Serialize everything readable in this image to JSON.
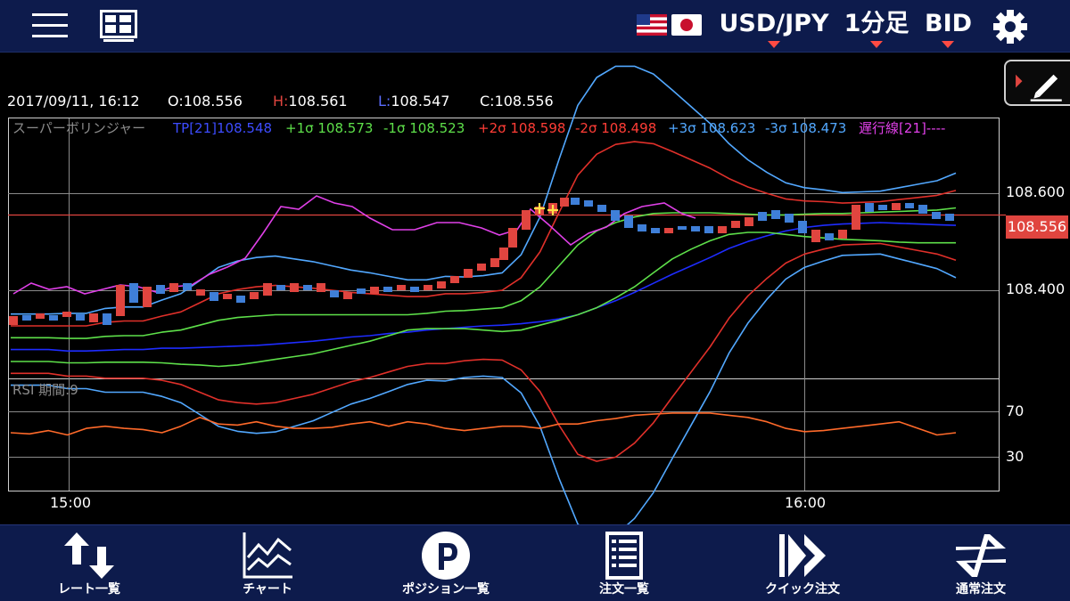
{
  "header": {
    "pair": "USD/JPY",
    "period": "1分足",
    "price_type": "BID",
    "icons": [
      "menu-icon",
      "layout-grid-icon",
      "us-flag-icon",
      "jp-flag-icon",
      "gear-icon"
    ]
  },
  "info": {
    "datetime": "2017/09/11, 16:12",
    "open_label": "O:",
    "open": "108.556",
    "high_label": "H:",
    "high": "108.561",
    "low_label": "L:",
    "low": "108.547",
    "close_label": "C:",
    "close": "108.556"
  },
  "indicator": {
    "name": "スーパーボリンジャー",
    "tp": "TP[21]108.548",
    "p1": "+1σ 108.573",
    "m1": "-1σ 108.523",
    "p2": "+2σ 108.598",
    "m2": "-2σ 108.498",
    "p3": "+3σ 108.623",
    "m3": "-3σ 108.473",
    "lag": "遅行線[21]----"
  },
  "rsi": {
    "label": "RSI 期間:9"
  },
  "axis": {
    "price_ticks": [
      "108.600",
      "108.400"
    ],
    "rsi_ticks": [
      "70",
      "30"
    ],
    "time_ticks": [
      "15:00",
      "16:00"
    ],
    "current_price": "108.556"
  },
  "colors": {
    "header_bg": "#0d1b4c",
    "up_candle": "#e0453f",
    "down_candle": "#3f7fd8",
    "tp": "#1e2cff",
    "sigma1": "#5ee04a",
    "sigma2": "#e0302a",
    "sigma3": "#52a8ff",
    "lag": "#e040e8",
    "rsi": "#ff6a2a"
  },
  "nav": {
    "rate": "レート一覧",
    "chart": "チャート",
    "positions": "ポジション一覧",
    "orders": "注文一覧",
    "quick": "クイック注文",
    "normal": "通常注文"
  },
  "chart_data": {
    "type": "line",
    "symbol": "USD/JPY",
    "y_range_price": [
      108.33,
      108.7
    ],
    "y_range_rsi": [
      0,
      100
    ],
    "x_ticks": [
      "15:00",
      "16:00"
    ],
    "price_ticks": [
      108.6,
      108.4
    ],
    "rsi_ticks": [
      70,
      30
    ],
    "current_price": 108.556,
    "series": [
      {
        "name": "TP[21]",
        "values": [
          108.37,
          108.37,
          108.37,
          108.368,
          108.368,
          108.369,
          108.37,
          108.37,
          108.372,
          108.372,
          108.373,
          108.374,
          108.375,
          108.376,
          108.378,
          108.38,
          108.382,
          108.385,
          108.388,
          108.39,
          108.393,
          108.395,
          108.398,
          108.4,
          108.402,
          108.404,
          108.405,
          108.407,
          108.41,
          108.414,
          108.42,
          108.43,
          108.44,
          108.452,
          108.465,
          108.478,
          108.49,
          108.502,
          108.515,
          108.525,
          108.533,
          108.54,
          108.545,
          108.548,
          108.55,
          108.551,
          108.552,
          108.551,
          108.55,
          108.549,
          108.548
        ]
      },
      {
        "name": "+1σ",
        "values": [
          108.387,
          108.387,
          108.387,
          108.386,
          108.386,
          108.389,
          108.39,
          108.39,
          108.395,
          108.398,
          108.405,
          108.412,
          108.416,
          108.418,
          108.42,
          108.42,
          108.42,
          108.42,
          108.42,
          108.42,
          108.42,
          108.42,
          108.422,
          108.425,
          108.426,
          108.428,
          108.43,
          108.44,
          108.46,
          108.49,
          108.52,
          108.54,
          108.552,
          108.56,
          108.565,
          108.566,
          108.566,
          108.566,
          108.565,
          108.564,
          108.563,
          108.563,
          108.564,
          108.565,
          108.565,
          108.566,
          108.567,
          108.568,
          108.569,
          108.57,
          108.573
        ]
      },
      {
        "name": "-1σ",
        "values": [
          108.353,
          108.353,
          108.353,
          108.351,
          108.351,
          108.352,
          108.352,
          108.352,
          108.351,
          108.349,
          108.348,
          108.346,
          108.348,
          108.352,
          108.356,
          108.36,
          108.364,
          108.37,
          108.376,
          108.382,
          108.39,
          108.398,
          108.4,
          108.4,
          108.4,
          108.398,
          108.396,
          108.398,
          108.405,
          108.412,
          108.42,
          108.43,
          108.444,
          108.46,
          108.48,
          108.5,
          108.514,
          108.526,
          108.535,
          108.538,
          108.538,
          108.535,
          108.532,
          108.53,
          108.528,
          108.527,
          108.526,
          108.524,
          108.523,
          108.523,
          108.523
        ]
      },
      {
        "name": "+2σ",
        "values": [
          108.404,
          108.404,
          108.404,
          108.404,
          108.404,
          108.409,
          108.411,
          108.411,
          108.418,
          108.424,
          108.437,
          108.45,
          108.456,
          108.46,
          108.462,
          108.46,
          108.458,
          108.455,
          108.452,
          108.45,
          108.448,
          108.446,
          108.446,
          108.45,
          108.45,
          108.452,
          108.455,
          108.473,
          108.51,
          108.566,
          108.62,
          108.65,
          108.664,
          108.668,
          108.665,
          108.654,
          108.642,
          108.63,
          108.615,
          108.603,
          108.594,
          108.586,
          108.583,
          108.582,
          108.58,
          108.581,
          108.582,
          108.585,
          108.588,
          108.591,
          108.598
        ]
      },
      {
        "name": "-2σ",
        "values": [
          108.336,
          108.336,
          108.336,
          108.332,
          108.332,
          108.329,
          108.329,
          108.329,
          108.326,
          108.32,
          108.309,
          108.298,
          108.294,
          108.292,
          108.294,
          108.3,
          108.306,
          108.315,
          108.324,
          108.33,
          108.338,
          108.346,
          108.35,
          108.35,
          108.354,
          108.356,
          108.355,
          108.341,
          108.31,
          108.262,
          108.22,
          108.21,
          108.216,
          108.236,
          108.265,
          108.302,
          108.338,
          108.374,
          108.415,
          108.447,
          108.472,
          108.494,
          108.507,
          108.514,
          108.52,
          108.521,
          108.522,
          108.517,
          108.512,
          108.507,
          108.498
        ]
      },
      {
        "name": "+3σ",
        "values": [
          108.421,
          108.421,
          108.421,
          108.422,
          108.422,
          108.429,
          108.431,
          108.431,
          108.441,
          108.45,
          108.469,
          108.488,
          108.497,
          108.502,
          108.504,
          108.5,
          108.496,
          108.49,
          108.484,
          108.48,
          108.475,
          108.47,
          108.47,
          108.475,
          108.474,
          108.476,
          108.48,
          108.506,
          108.56,
          108.642,
          108.72,
          108.76,
          108.776,
          108.776,
          108.765,
          108.742,
          108.718,
          108.694,
          108.665,
          108.642,
          108.624,
          108.609,
          108.602,
          108.599,
          108.595,
          108.596,
          108.597,
          108.602,
          108.607,
          108.612,
          108.623
        ]
      },
      {
        "name": "-3σ",
        "values": [
          108.319,
          108.319,
          108.319,
          108.314,
          108.314,
          108.309,
          108.309,
          108.309,
          108.303,
          108.294,
          108.277,
          108.26,
          108.253,
          108.25,
          108.252,
          108.26,
          108.268,
          108.28,
          108.292,
          108.3,
          108.31,
          108.32,
          108.326,
          108.325,
          108.33,
          108.332,
          108.33,
          108.308,
          108.26,
          108.186,
          108.12,
          108.1,
          108.104,
          108.128,
          108.165,
          108.214,
          108.262,
          108.31,
          108.365,
          108.408,
          108.442,
          108.471,
          108.488,
          108.497,
          108.505,
          108.506,
          108.507,
          108.5,
          108.493,
          108.486,
          108.473
        ]
      },
      {
        "name": "RSI",
        "values": [
          52,
          51,
          54,
          50,
          56,
          58,
          56,
          55,
          52,
          58,
          66,
          60,
          59,
          62,
          58,
          56,
          56,
          57,
          60,
          62,
          58,
          62,
          60,
          56,
          54,
          56,
          58,
          58,
          56,
          60,
          60,
          63,
          65,
          68,
          69,
          70,
          70,
          70,
          68,
          66,
          62,
          56,
          53,
          54,
          56,
          58,
          60,
          62,
          56,
          50,
          52
        ]
      }
    ]
  }
}
